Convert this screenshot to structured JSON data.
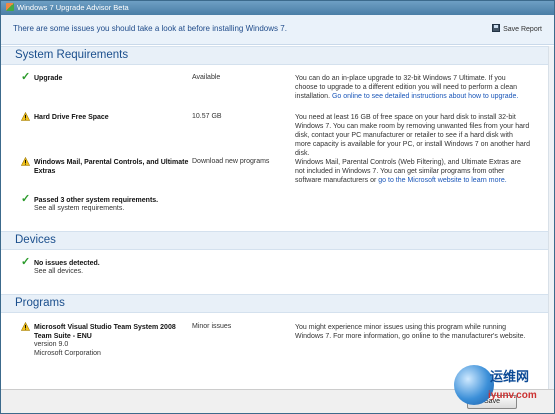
{
  "window": {
    "title": "Windows 7 Upgrade Advisor Beta"
  },
  "header": {
    "message": "There are some issues you should take a look at before installing Windows 7.",
    "save_label": "Save Report"
  },
  "sections": {
    "system": {
      "title": "System Requirements",
      "items": [
        {
          "icon": "check-icon",
          "name": "Upgrade",
          "status": "Available",
          "desc": "You can do an in-place upgrade to 32-bit Windows 7 Ultimate. If you choose to upgrade to a different edition you will need to perform a clean installation.",
          "link": "Go online to see detailed instructions about how to upgrade."
        },
        {
          "icon": "warning-icon",
          "name": "Hard Drive Free Space",
          "status": "10.57 GB",
          "desc": "You need at least 16 GB of free space on your hard disk to install 32-bit Windows 7. You can make room by removing unwanted files from your hard disk, contact your PC manufacturer or retailer to see if a hard disk with more capacity is available for your PC, or install Windows 7 on another hard disk."
        },
        {
          "icon": "warning-icon",
          "name": "Windows Mail, Parental Controls, and Ultimate Extras",
          "status": "Download new programs",
          "desc": "Windows Mail, Parental Controls (Web Filtering), and Ultimate Extras are not included in Windows 7. You can get similar programs from other software manufacturers or",
          "link": "go to the Microsoft website to learn more."
        }
      ],
      "summary": {
        "name": "Passed 3 other system requirements.",
        "link": "See all system requirements."
      }
    },
    "devices": {
      "title": "Devices",
      "summary": {
        "name": "No issues detected.",
        "link": "See all devices."
      }
    },
    "programs": {
      "title": "Programs",
      "items": [
        {
          "icon": "warning-icon",
          "name": "Microsoft Visual Studio Team System 2008 Team Suite - ENU",
          "version": "version 9.0",
          "publisher": "Microsoft Corporation",
          "status": "Minor issues",
          "desc": "You might experience minor issues using this program while running Windows 7. For more information, go online to the manufacturer's website."
        }
      ]
    }
  },
  "footer": {
    "button_label": "Save"
  },
  "watermark": {
    "line1": "运维网",
    "line2": "iyunv.com"
  }
}
